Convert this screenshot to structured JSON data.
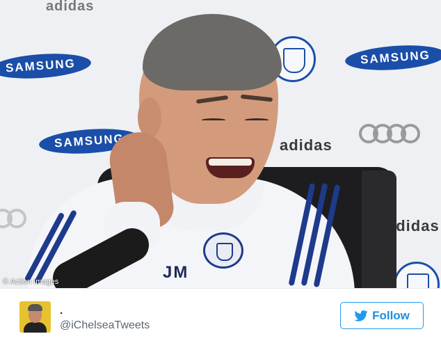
{
  "photo": {
    "credit": "© Action Images",
    "shirt_initials": "JM",
    "sponsors": {
      "adidas": "adidas",
      "samsung": "SAMSUNG",
      "jacket_brand": "adidas"
    }
  },
  "tweet": {
    "display_name": ".",
    "handle": "@iChelseaTweets",
    "follow_label": "Follow",
    "icons": {
      "avatar": "avatar-image",
      "follow": "twitter-bird-icon"
    },
    "colors": {
      "accent": "#1d9bf0"
    }
  }
}
